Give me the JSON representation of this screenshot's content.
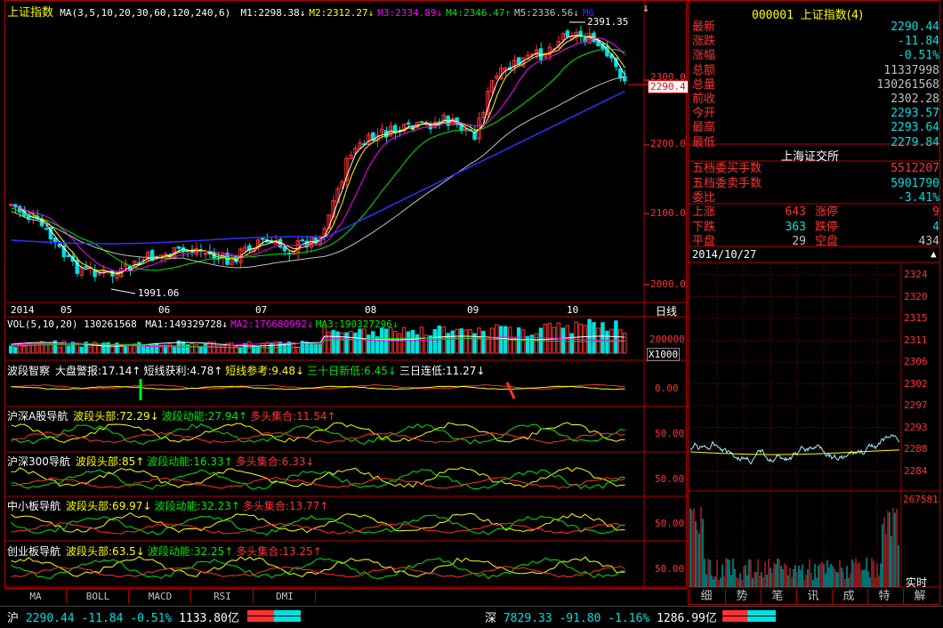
{
  "colors": {
    "up": "#ff3232",
    "down": "#00e0e0",
    "panel_border": "#b40000"
  },
  "chart": {
    "title": "上证指数",
    "ma_label": "MA(3,5,10,20,30,60,120,240,6)",
    "ma": [
      {
        "label": "M1:2298.38",
        "arrow": "↓",
        "color": "#ffffff"
      },
      {
        "label": "M2:2312.27",
        "arrow": "↓",
        "color": "#ffff00"
      },
      {
        "label": "M3:2334.89",
        "arrow": "↓",
        "color": "#ff00ff"
      },
      {
        "label": "M4:2346.47",
        "arrow": "↑",
        "color": "#00e600"
      },
      {
        "label": "M5:2336.56",
        "arrow": "↓",
        "color": "#c0c0c0"
      },
      {
        "label": "M6",
        "arrow": "",
        "color": "#3030ff"
      }
    ],
    "high_label": "2391.35",
    "low_label": "1991.06",
    "price_tag": "2290.4",
    "y_ticks": [
      "2300.0",
      "2200.0",
      "2100.0",
      "2000.0"
    ],
    "months": [
      "2014",
      "05",
      "06",
      "07",
      "08",
      "09",
      "10"
    ],
    "period": "日线"
  },
  "vol": {
    "label": "VOL(5,10,20)",
    "value": "130261568",
    "mas": [
      {
        "label": "MA1:149329728",
        "arrow": "↓",
        "color": "#ffffff"
      },
      {
        "label": "MA2:176680992",
        "arrow": "↓",
        "color": "#ff00ff"
      },
      {
        "label": "MA3:190327296",
        "arrow": "↓",
        "color": "#00e600"
      }
    ],
    "tick": "200000",
    "unit": "X1000"
  },
  "indicators": [
    {
      "name": "波段智察",
      "parts": [
        {
          "t": "大盘警报:17.14",
          "a": "↑",
          "c": "#ffffff"
        },
        {
          "t": "短线获利:4.78",
          "a": "↑",
          "c": "#ffffff"
        },
        {
          "t": "短线参考:9.48",
          "a": "↓",
          "c": "#ffff00"
        },
        {
          "t": "三十日新低:6.45",
          "a": "↓",
          "c": "#00e600"
        },
        {
          "t": "三日连低:11.27",
          "a": "↓",
          "c": "#ffffff"
        }
      ],
      "tick": "0.00"
    },
    {
      "name": "沪深A股导航",
      "parts": [
        {
          "t": "波段头部:72.29",
          "a": "↓",
          "c": "#ffff00"
        },
        {
          "t": "波段动能:27.94",
          "a": "↑",
          "c": "#00e600"
        },
        {
          "t": "多头集合:11.54",
          "a": "↑",
          "c": "#ff3232"
        }
      ],
      "tick": "50.00"
    },
    {
      "name": "沪深300导航",
      "parts": [
        {
          "t": "波段头部:85",
          "a": "↑",
          "c": "#ffff00"
        },
        {
          "t": "波段动能:16.33",
          "a": "↑",
          "c": "#00e600"
        },
        {
          "t": "多头集合:6.33",
          "a": "↓",
          "c": "#ff3232"
        }
      ],
      "tick": "50.00"
    },
    {
      "name": "中小板导航",
      "parts": [
        {
          "t": "波段头部:69.97",
          "a": "↓",
          "c": "#ffff00"
        },
        {
          "t": "波段动能:32.23",
          "a": "↑",
          "c": "#00e600"
        },
        {
          "t": "多头集合:13.77",
          "a": "↑",
          "c": "#ff3232"
        }
      ],
      "tick": "50.00"
    },
    {
      "name": "创业板导航",
      "parts": [
        {
          "t": "波段头部:63.5",
          "a": "↓",
          "c": "#ffff00"
        },
        {
          "t": "波段动能:32.25",
          "a": "↑",
          "c": "#00e600"
        },
        {
          "t": "多头集合:13.25",
          "a": "↑",
          "c": "#ff3232"
        }
      ],
      "tick": "50.00"
    }
  ],
  "bottom_tabs": [
    "MA",
    "BOLL",
    "MACD",
    "RSI",
    "DMI"
  ],
  "right": {
    "code": "000001",
    "name": "上证指数(4)",
    "quote": [
      {
        "label": "最新",
        "value": "2290.44",
        "color": "#00e0e0"
      },
      {
        "label": "涨跌",
        "value": "-11.84",
        "color": "#00e0e0"
      },
      {
        "label": "涨幅",
        "value": "-0.51%",
        "color": "#00e0e0"
      },
      {
        "label": "总额",
        "value": "11337998",
        "color": "#c0c0c0"
      },
      {
        "label": "总量",
        "value": "130261568",
        "color": "#c0c0c0"
      },
      {
        "label": "前收",
        "value": "2302.28",
        "color": "#c0c0c0"
      },
      {
        "label": "今开",
        "value": "2293.57",
        "color": "#00e0e0"
      },
      {
        "label": "最高",
        "value": "2293.64",
        "color": "#00e0e0"
      },
      {
        "label": "最低",
        "value": "2279.84",
        "color": "#00e0e0"
      }
    ],
    "exchange": "上海证交所",
    "order": [
      {
        "label": "五档委买手数",
        "value": "5512207",
        "color": "#ff3232"
      },
      {
        "label": "五档委卖手数",
        "value": "5901790",
        "color": "#00e0e0"
      },
      {
        "label": "委比",
        "value": "-3.41%",
        "color": "#00e0e0"
      }
    ],
    "breadth": [
      {
        "l1": "上涨",
        "v1": "643",
        "c1": "#ff3232",
        "l2": "涨停",
        "v2": "9",
        "c2": "#ff3232"
      },
      {
        "l1": "下跌",
        "v1": "363",
        "c1": "#00e0e0",
        "l2": "跌停",
        "v2": "4",
        "c2": "#00e0e0"
      },
      {
        "l1": "平盘",
        "v1": "29",
        "c1": "#c0c0c0",
        "l2": "空盘",
        "v2": "434",
        "c2": "#c0c0c0"
      }
    ],
    "date": "2014/10/27",
    "mini_ticks": [
      "2324",
      "2320",
      "2315",
      "2311",
      "2306",
      "2302",
      "2297",
      "2293",
      "2288",
      "2284"
    ],
    "mini_vol_tick": "267581",
    "realtime": "实时",
    "tabs": [
      "细",
      "势",
      "笔",
      "讯",
      "成",
      "特",
      "解"
    ]
  },
  "status": {
    "sh_label": "沪",
    "sh_price": "2290.44",
    "sh_chg": "-11.84",
    "sh_pct": "-0.51%",
    "sh_amt": "1133.80亿",
    "sz_label": "深",
    "sz_price": "7829.33",
    "sz_chg": "-91.80",
    "sz_pct": "-1.16%",
    "sz_amt": "1286.99亿"
  }
}
